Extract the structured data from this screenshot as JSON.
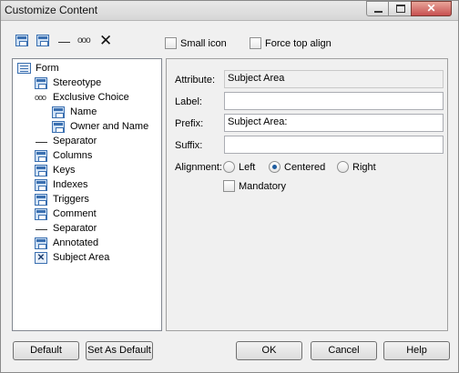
{
  "window": {
    "title": "Customize Content"
  },
  "toolbar": {
    "small_icon_label": "Small icon",
    "force_top_align_label": "Force top align",
    "separator_glyph": "ooo"
  },
  "tree": {
    "items": [
      {
        "label": "Form",
        "icon": "form-icon"
      },
      {
        "label": "Stereotype",
        "icon": "attribute-icon"
      },
      {
        "label": "Exclusive Choice",
        "icon": "exclusive-choice-icon"
      },
      {
        "label": "Name",
        "icon": "attribute-icon"
      },
      {
        "label": "Owner and Name",
        "icon": "attribute-icon"
      },
      {
        "label": "Separator",
        "icon": "separator-line-icon"
      },
      {
        "label": "Columns",
        "icon": "attribute-icon"
      },
      {
        "label": "Keys",
        "icon": "attribute-icon"
      },
      {
        "label": "Indexes",
        "icon": "attribute-icon"
      },
      {
        "label": "Triggers",
        "icon": "attribute-icon"
      },
      {
        "label": "Comment",
        "icon": "attribute-icon"
      },
      {
        "label": "Separator",
        "icon": "separator-line-icon"
      },
      {
        "label": "Annotated",
        "icon": "attribute-icon"
      },
      {
        "label": "Subject Area",
        "icon": "x-attribute-icon"
      }
    ]
  },
  "props": {
    "attribute_label": "Attribute:",
    "attribute_value": "Subject Area",
    "label_label": "Label:",
    "label_value": "",
    "prefix_label": "Prefix:",
    "prefix_value": "Subject Area:",
    "suffix_label": "Suffix:",
    "suffix_value": "",
    "alignment_label": "Alignment:",
    "align_left": "Left",
    "align_centered": "Centered",
    "align_right": "Right",
    "alignment_selected": "Centered",
    "mandatory_label": "Mandatory"
  },
  "buttons": {
    "default": "Default",
    "set_as_default": "Set As Default",
    "ok": "OK",
    "cancel": "Cancel",
    "help": "Help"
  }
}
